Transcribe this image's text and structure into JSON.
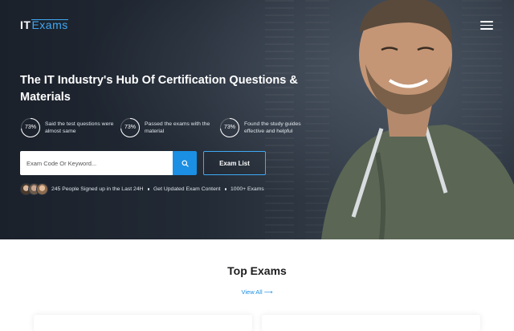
{
  "header": {
    "logo_it": "IT",
    "logo_exams": "Exams",
    "menu_icon": "hamburger-menu-icon"
  },
  "hero": {
    "headline": "The IT Industry's Hub Of Certification Questions & Materials",
    "stats": [
      {
        "percent": "73%",
        "value": 0.73,
        "text": "Said the test questions were almost same"
      },
      {
        "percent": "73%",
        "value": 0.73,
        "text": "Passed the exams with the material"
      },
      {
        "percent": "73%",
        "value": 0.73,
        "text": "Found the study guides effective and helpful"
      }
    ],
    "search": {
      "placeholder": "Exam Code Or Keyword...",
      "value": "",
      "icon": "search-icon"
    },
    "exam_list_label": "Exam List",
    "social": {
      "signup_text": "245 People Signed up in the Last 24H",
      "updated_text": "Get Updated Exam Content",
      "exams_text": "1000+ Exams"
    }
  },
  "top_exams": {
    "title": "Top Exams",
    "view_all_label": "View All ⟶"
  },
  "colors": {
    "accent": "#1a8fe3",
    "accent_light": "#3fa9f5",
    "hero_bg": "#222a35",
    "text_dark": "#1d1d1f"
  }
}
